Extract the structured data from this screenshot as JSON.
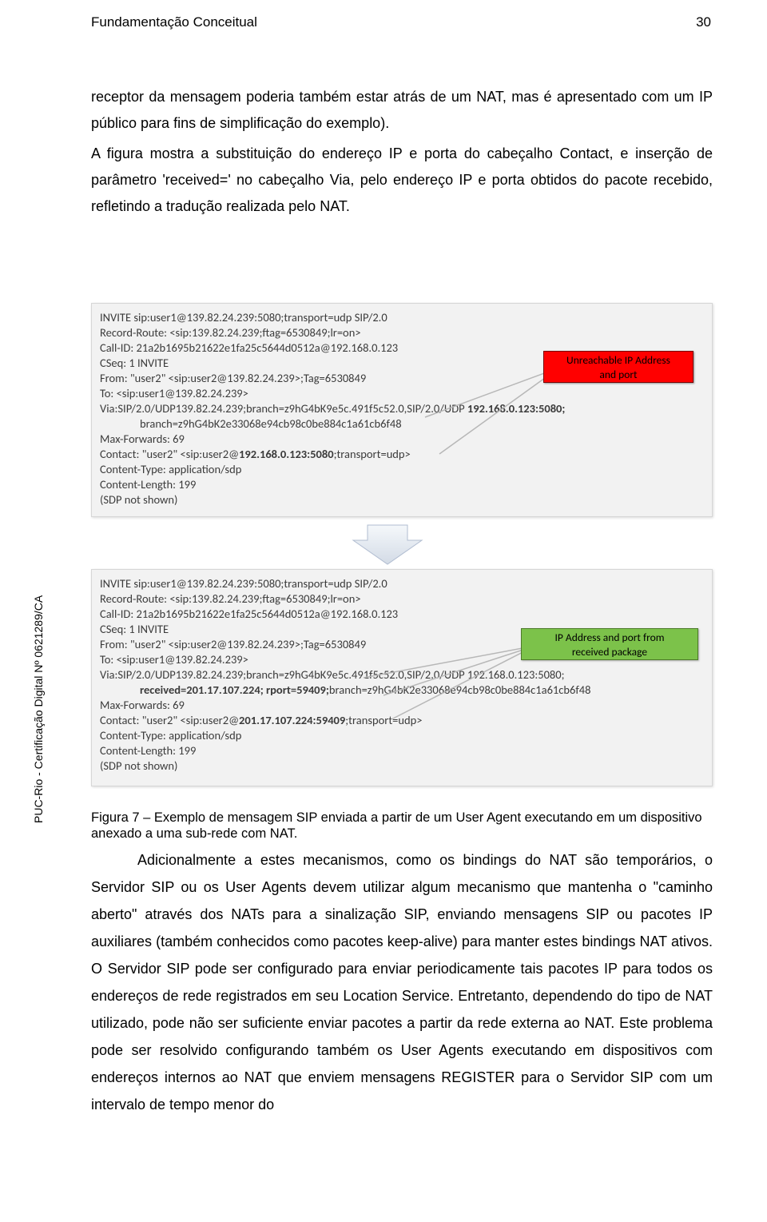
{
  "header": {
    "title": "Fundamentação Conceitual",
    "page": "30"
  },
  "para1": "receptor da mensagem poderia também estar atrás de um NAT, mas é apresentado com um IP público para fins de simplificação do exemplo).",
  "para2": "A figura mostra a substituição do endereço IP e porta do cabeçalho Contact, e inserção de parâmetro 'received=' no cabeçalho Via, pelo endereço IP e porta obtidos do pacote recebido, refletindo a tradução realizada pelo NAT.",
  "sip1": {
    "l1": "INVITE sip:user1@139.82.24.239:5080;transport=udp  SIP/2.0",
    "l2": "Record-Route: <sip:139.82.24.239;ftag=6530849;lr=on>",
    "l3": "Call-ID: 21a2b1695b21622e1fa25c5644d0512a@192.168.0.123",
    "l4": "CSeq: 1 INVITE",
    "l5": "From: \"user2\" <sip:user2@139.82.24.239>;Tag=6530849",
    "l6": "To: <sip:user1@139.82.24.239>",
    "l7a": "Via:SIP/2.0/UDP139.82.24.239;branch=z9hG4bK9e5c.491f5c52.0,SIP/2.0/UDP ",
    "l7b": "192.168.0.123:5080;",
    "l8": "branch=z9hG4bK2e33068e94cb98c0be884c1a61cb6f48",
    "l9": "Max-Forwards: 69",
    "l10a": "Contact: \"user2\" <sip:user2@",
    "l10b": "192.168.0.123:5080",
    "l10c": ";transport=udp>",
    "l11": "Content-Type: application/sdp",
    "l12": "Content-Length: 199",
    "l13": "(SDP not shown)"
  },
  "callout_red": {
    "line1": "Unreachable IP Address",
    "line2": "and port"
  },
  "sip2": {
    "l1": "INVITE sip:user1@139.82.24.239:5080;transport=udp  SIP/2.0",
    "l2": "Record-Route: <sip:139.82.24.239;ftag=6530849;lr=on>",
    "l3": "Call-ID: 21a2b1695b21622e1fa25c5644d0512a@192.168.0.123",
    "l4": "CSeq: 1 INVITE",
    "l5": "From: \"user2\" <sip:user2@139.82.24.239>;Tag=6530849",
    "l6": "To: <sip:user1@139.82.24.239>",
    "l7": "Via:SIP/2.0/UDP139.82.24.239;branch=z9hG4bK9e5c.491f5c52.0,SIP/2.0/UDP  192.168.0.123:5080;",
    "l8a": "received=201.17.107.224;  rport=59409;",
    "l8b": "branch=z9hG4bK2e33068e94cb98c0be884c1a61cb6f48",
    "l9": "Max-Forwards: 69",
    "l10a": "Contact: \"user2\" <sip:user2@",
    "l10b": "201.17.107.224:59409",
    "l10c": ";transport=udp>",
    "l11": "Content-Type: application/sdp",
    "l12": "Content-Length: 199",
    "l13": "(SDP not shown)"
  },
  "callout_green": {
    "line1": "IP Address and port from",
    "line2": "received package"
  },
  "figcaption": "Figura 7 – Exemplo de mensagem SIP enviada a partir de um User Agent executando em um dispositivo anexado a uma sub-rede com NAT.",
  "para3": "Adicionalmente a estes mecanismos, como os bindings do NAT são temporários, o Servidor SIP ou os User Agents devem utilizar algum mecanismo que mantenha o \"caminho aberto\" através dos NATs para a sinalização SIP, enviando mensagens SIP ou pacotes IP auxiliares (também conhecidos como pacotes keep-alive) para manter estes bindings NAT ativos. O Servidor SIP pode ser configurado para enviar periodicamente tais pacotes IP para todos os endereços de rede registrados em seu Location Service. Entretanto, dependendo do tipo de NAT utilizado, pode não ser suficiente enviar pacotes a partir da rede externa ao NAT. Este problema pode ser resolvido configurando também os User Agents executando em dispositivos com endereços internos ao NAT que enviem mensagens REGISTER para o Servidor SIP com um intervalo de tempo menor do",
  "side": "PUC-Rio - Certificação Digital Nº 0621289/CA"
}
